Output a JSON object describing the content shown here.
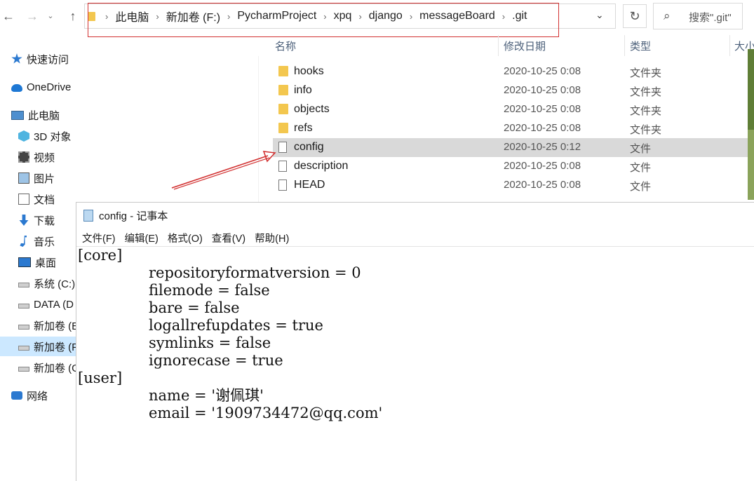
{
  "explorer": {
    "breadcrumbs": [
      "此电脑",
      "新加卷 (F:)",
      "PycharmProject",
      "xpq",
      "django",
      "messageBoard",
      ".git"
    ],
    "search_placeholder": "搜索\".git\"",
    "columns": {
      "name": "名称",
      "date": "修改日期",
      "type": "类型",
      "size": "大小"
    },
    "files": [
      {
        "name": "hooks",
        "date": "2020-10-25 0:08",
        "type": "文件夹",
        "icon": "folder-icon"
      },
      {
        "name": "info",
        "date": "2020-10-25 0:08",
        "type": "文件夹",
        "icon": "folder-icon"
      },
      {
        "name": "objects",
        "date": "2020-10-25 0:08",
        "type": "文件夹",
        "icon": "folder-icon"
      },
      {
        "name": "refs",
        "date": "2020-10-25 0:08",
        "type": "文件夹",
        "icon": "folder-icon"
      },
      {
        "name": "config",
        "date": "2020-10-25 0:12",
        "type": "文件",
        "icon": "file-icon",
        "selected": true
      },
      {
        "name": "description",
        "date": "2020-10-25 0:08",
        "type": "文件",
        "icon": "file-icon"
      },
      {
        "name": "HEAD",
        "date": "2020-10-25 0:08",
        "type": "文件",
        "icon": "file-icon"
      }
    ]
  },
  "sidebar": {
    "items": [
      {
        "label": "快速访问",
        "icon": "star-icon"
      },
      {
        "label": "OneDrive",
        "icon": "cloud-icon"
      },
      {
        "label": "此电脑",
        "icon": "pc-icon"
      },
      {
        "label": "3D 对象",
        "icon": "cube-icon"
      },
      {
        "label": "视频",
        "icon": "video-icon"
      },
      {
        "label": "图片",
        "icon": "picture-icon"
      },
      {
        "label": "文档",
        "icon": "document-icon"
      },
      {
        "label": "下载",
        "icon": "download-icon"
      },
      {
        "label": "音乐",
        "icon": "music-icon"
      },
      {
        "label": "桌面",
        "icon": "desktop-icon"
      },
      {
        "label": "系统 (C:)",
        "icon": "drive-icon"
      },
      {
        "label": "DATA (D",
        "icon": "drive-icon"
      },
      {
        "label": "新加卷 (E",
        "icon": "drive-icon"
      },
      {
        "label": "新加卷 (F",
        "icon": "drive-icon",
        "selected": true
      },
      {
        "label": "新加卷 (G",
        "icon": "drive-icon"
      },
      {
        "label": "网络",
        "icon": "network-icon"
      }
    ]
  },
  "notepad": {
    "title": "config - 记事本",
    "menu": [
      "文件(F)",
      "编辑(E)",
      "格式(O)",
      "查看(V)",
      "帮助(H)"
    ],
    "lines": [
      "[core]",
      "\trepositoryformatversion = 0",
      "\tfilemode = false",
      "\tbare = false",
      "\tlogallrefupdates = true",
      "\tsymlinks = false",
      "\tignorecase = true",
      "[user]",
      "\tname = '谢佩琪'",
      "\temail = '1909734472@qq.com'"
    ]
  },
  "colors": {
    "highlight_box": "#d23232",
    "folder": "#f3c74f",
    "selected_row": "#d9d9d9",
    "selected_nav": "#cce8ff"
  }
}
